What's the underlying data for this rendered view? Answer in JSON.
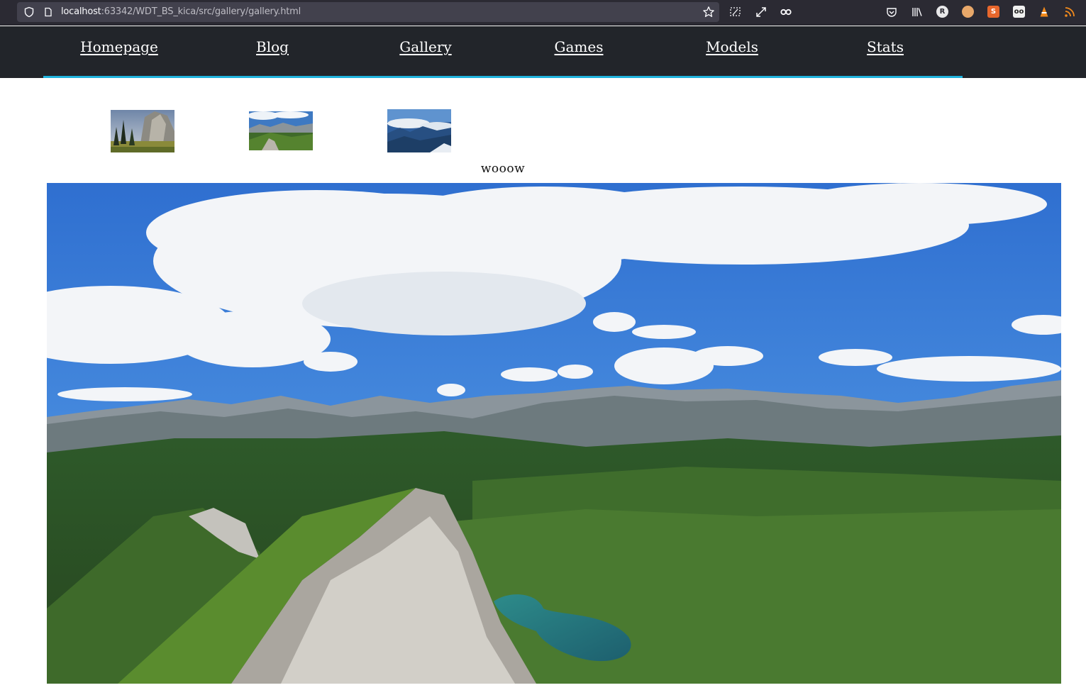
{
  "browser": {
    "url_host": "localhost",
    "url_rest": ":63342/WDT_BS_kica/src/gallery/gallery.html"
  },
  "nav": {
    "items": [
      {
        "label": "Homepage"
      },
      {
        "label": "Blog"
      },
      {
        "label": "Gallery"
      },
      {
        "label": "Games"
      },
      {
        "label": "Models"
      },
      {
        "label": "Stats"
      }
    ]
  },
  "gallery": {
    "caption": "wooow",
    "thumbnails": [
      {
        "icon": "cliff-forest-thumbnail"
      },
      {
        "icon": "mountain-ridge-thumbnail"
      },
      {
        "icon": "alpine-clouds-thumbnail"
      }
    ]
  },
  "colors": {
    "nav_background": "#22252a",
    "nav_accent": "#1fb3dd",
    "browser_bar": "#2b2a33",
    "url_box": "#42414d"
  }
}
